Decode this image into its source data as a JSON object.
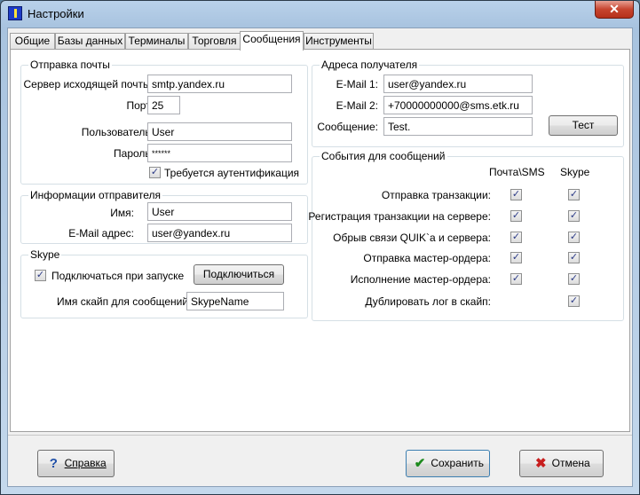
{
  "window": {
    "title": "Настройки",
    "close_glyph": "✕"
  },
  "tabs": [
    {
      "label": "Общие"
    },
    {
      "label": "Базы данных"
    },
    {
      "label": "Терминалы"
    },
    {
      "label": "Торговля"
    },
    {
      "label": "Сообщения",
      "active": true
    },
    {
      "label": "Инструменты"
    }
  ],
  "mail": {
    "legend": "Отправка почты",
    "server_label": "Сервер исходящей почты:",
    "server_value": "smtp.yandex.ru",
    "port_label": "Порт:",
    "port_value": "25",
    "user_label": "Пользователь:",
    "user_value": "User",
    "password_label": "Пароль:",
    "password_value": "******",
    "auth_label": "Требуется аутентификация",
    "auth_checked": true
  },
  "sender": {
    "legend": "Информации отправителя",
    "name_label": "Имя:",
    "name_value": "User",
    "email_label": "E-Mail адрес:",
    "email_value": "user@yandex.ru"
  },
  "skype": {
    "legend": "Skype",
    "autoconnect_label": "Подключаться при запуске",
    "autoconnect_checked": true,
    "connect_button": "Подключиться",
    "name_label": "Имя скайп для сообщений:",
    "name_value": "SkypeName"
  },
  "recipient": {
    "legend": "Адреса получателя",
    "email1_label": "E-Mail 1:",
    "email1_value": "user@yandex.ru",
    "email2_label": "E-Mail 2:",
    "email2_value": "+70000000000@sms.etk.ru",
    "message_label": "Сообщение:",
    "message_value": "Test.",
    "test_button": "Тест"
  },
  "events": {
    "legend": "События для сообщений",
    "col_mail": "Почта\\SMS",
    "col_skype": "Skype",
    "rows": [
      {
        "label": "Отправка транзакции:",
        "mail": true,
        "skype": true
      },
      {
        "label": "Регистрация транзакции на сервере:",
        "mail": true,
        "skype": true
      },
      {
        "label": "Обрыв связи QUIK`а и сервера:",
        "mail": true,
        "skype": true
      },
      {
        "label": "Отправка мастер-ордера:",
        "mail": true,
        "skype": true
      },
      {
        "label": "Исполнение мастер-ордера:",
        "mail": true,
        "skype": true
      },
      {
        "label": "Дублировать лог в скайп:",
        "mail": null,
        "skype": true
      }
    ]
  },
  "footer": {
    "help_button": "Справка",
    "save_button": "Сохранить",
    "cancel_button": "Отмена"
  },
  "colors": {
    "help_icon": "#1f4fa8",
    "save_icon": "#1d8a1d",
    "cancel_icon": "#c81e1e"
  }
}
